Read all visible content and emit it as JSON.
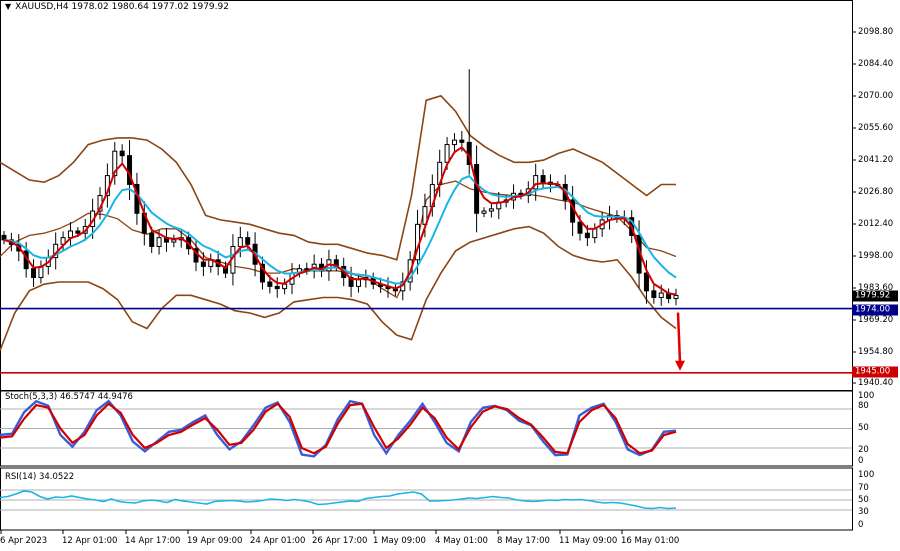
{
  "header": {
    "symbol_line": "XAUUSD,H4  1978.02 1980.64 1977.02 1979.92"
  },
  "colors": {
    "candle": "#000000",
    "bollinger": "#8B4513",
    "ma_fast": "#d00000",
    "ma_slow": "#19b5e6",
    "support_line": "#00008B",
    "target_line": "#cc0000",
    "arrow": "#e00000",
    "stoch_main": "#3b5bd6",
    "stoch_signal": "#d00000",
    "rsi": "#19b5e6"
  },
  "price_axis": {
    "ticks": [
      "2098.80",
      "2084.40",
      "2070.00",
      "2055.60",
      "2041.20",
      "2026.80",
      "2012.40",
      "1998.00",
      "1983.60",
      "1969.20",
      "1954.80",
      "1940.40"
    ],
    "current_label": "1979.92",
    "support_label": "1974.00",
    "target_label": "1945.00"
  },
  "stoch_panel": {
    "label": "Stoch(5,3,3) 46.5747 44.9476",
    "ticks": [
      "100",
      "80",
      "50",
      "20",
      "0"
    ]
  },
  "rsi_panel": {
    "label": "RSI(14) 34.0522",
    "ticks": [
      "100",
      "70",
      "50",
      "30",
      "0"
    ]
  },
  "time_axis": {
    "labels": [
      "6 Apr 2023",
      "12 Apr 01:00",
      "14 Apr 17:00",
      "19 Apr 09:00",
      "24 Apr 01:00",
      "26 Apr 17:00",
      "1 May 09:00",
      "4 May 01:00",
      "8 May 17:00",
      "11 May 09:00",
      "16 May 01:00"
    ]
  },
  "chart_data": {
    "type": "candlestick",
    "symbol": "XAUUSD",
    "timeframe": "H4",
    "ohlc_last": {
      "open": 1978.02,
      "high": 1980.64,
      "low": 1977.02,
      "close": 1979.92
    },
    "ylim": [
      1940.4,
      2108.0
    ],
    "horizontal_levels": [
      {
        "label": "1974.00",
        "value": 1974.0
      },
      {
        "label": "1945.00",
        "value": 1945.0
      }
    ],
    "closes": [
      2005,
      2003,
      2000,
      1992,
      1988,
      1993,
      1997,
      2003,
      2006,
      2009,
      2008,
      2011,
      2018,
      2025,
      2034,
      2045,
      2043,
      2030,
      2017,
      2008,
      2002,
      2006,
      2004,
      2005,
      2006,
      2001,
      1995,
      1993,
      1996,
      1993,
      1990,
      2002,
      2006,
      2003,
      1994,
      1986,
      1984,
      1983,
      1985,
      1990,
      1992,
      1992,
      1994,
      1991,
      1996,
      1993,
      1988,
      1984,
      1987,
      1988,
      1985,
      1984,
      1983,
      1982,
      1986,
      1996,
      2012,
      2020,
      2030,
      2040,
      2048,
      2050,
      2049,
      2039,
      2017,
      2018,
      2019,
      2022,
      2023,
      2026,
      2025,
      2028,
      2034,
      2031,
      2030,
      2030,
      2023,
      2013,
      2008,
      2006,
      2010,
      2014,
      2016,
      2015,
      2015,
      2007,
      1990,
      1982,
      1979,
      1981,
      1978.5,
      1979.92
    ],
    "bollinger_upper": [
      2040,
      2036,
      2032,
      2031,
      2034,
      2040,
      2048,
      2050,
      2051,
      2051,
      2050,
      2046,
      2040,
      2030,
      2016,
      2014,
      2013,
      2012,
      2010,
      2008,
      2007,
      2004,
      2003,
      2003,
      2001,
      1999,
      1998,
      1996,
      2025,
      2068,
      2070,
      2063,
      2052,
      2047,
      2043,
      2040,
      2040,
      2041,
      2044,
      2046,
      2043,
      2040,
      2035,
      2030,
      2025,
      2030,
      2030
    ],
    "bollinger_lower": [
      1955,
      1972,
      1982,
      1985,
      1986,
      1986,
      1986,
      1983,
      1978,
      1968,
      1965,
      1974,
      1980,
      1980,
      1978,
      1976,
      1973,
      1972,
      1970,
      1972,
      1977,
      1978,
      1979,
      1979,
      1978,
      1976,
      1968,
      1962,
      1960,
      1978,
      1990,
      2000,
      2004,
      2006,
      2008,
      2010,
      2011,
      2008,
      2002,
      1998,
      1996,
      1995,
      1996,
      1988,
      1978,
      1970,
      1965
    ],
    "stochastic": {
      "params": "5,3,3",
      "main_last": 46.5747,
      "signal_last": 44.9476,
      "main": [
        40,
        42,
        75,
        92,
        85,
        40,
        22,
        45,
        78,
        92,
        70,
        30,
        15,
        30,
        45,
        48,
        60,
        70,
        40,
        18,
        30,
        55,
        82,
        90,
        60,
        10,
        7,
        25,
        65,
        92,
        88,
        40,
        12,
        40,
        62,
        88,
        60,
        28,
        15,
        60,
        82,
        85,
        78,
        62,
        55,
        30,
        9,
        10,
        70,
        82,
        88,
        60,
        18,
        9,
        17,
        45,
        46.5747
      ],
      "signal": [
        36,
        38,
        65,
        86,
        82,
        50,
        28,
        40,
        70,
        88,
        74,
        40,
        20,
        28,
        40,
        45,
        56,
        66,
        48,
        25,
        28,
        48,
        76,
        88,
        68,
        20,
        12,
        22,
        58,
        86,
        88,
        52,
        20,
        35,
        56,
        82,
        66,
        36,
        18,
        52,
        76,
        84,
        80,
        66,
        56,
        36,
        14,
        12,
        60,
        78,
        86,
        66,
        26,
        12,
        16,
        40,
        44.9476
      ]
    },
    "rsi": {
      "period": 14,
      "last": 34.0522,
      "values": [
        55,
        57,
        62,
        68,
        66,
        57,
        52,
        56,
        55,
        58,
        55,
        52,
        50,
        47,
        52,
        47,
        45,
        44,
        48,
        50,
        48,
        45,
        51,
        48,
        46,
        44,
        42,
        47,
        48,
        49,
        48,
        46,
        47,
        49,
        52,
        51,
        49,
        51,
        49,
        46,
        41,
        42,
        44,
        46,
        48,
        47,
        53,
        55,
        57,
        58,
        62,
        64,
        66,
        62,
        48,
        48,
        49,
        50,
        52,
        54,
        53,
        55,
        57,
        55,
        54,
        50,
        48,
        47,
        48,
        50,
        49,
        51,
        50,
        51,
        49,
        46,
        44,
        45,
        44,
        41,
        38,
        34,
        33,
        35,
        33,
        34.0522
      ]
    },
    "annotations": [
      "downward arrow from 1974.00 toward 1945.00"
    ]
  }
}
